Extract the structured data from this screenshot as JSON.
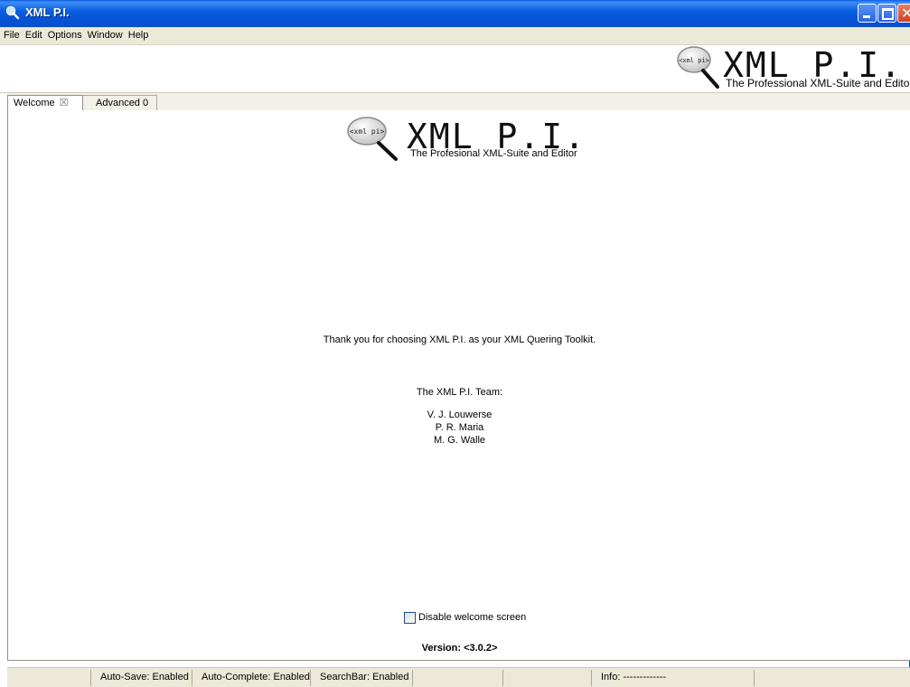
{
  "window": {
    "title": "XML P.I."
  },
  "menu": [
    "File",
    "Edit",
    "Options",
    "Window",
    "Help"
  ],
  "banner": {
    "logo_badge": "<xml pi>",
    "title": "XML P.I.",
    "subtitle": "The Professional XML-Suite and Editor"
  },
  "tabs": [
    {
      "label": "Welcome",
      "close": "☒",
      "active": true
    },
    {
      "label": "Advanced 0",
      "active": false
    }
  ],
  "welcome": {
    "logo_badge": "<xml pi>",
    "title": "XML P.I.",
    "subtitle": "The Profesional XML-Suite and Editor",
    "thanks": "Thank you for choosing XML P.I. as your XML Quering Toolkit.",
    "team_heading": "The XML P.I. Team:",
    "team_members": [
      "V. J. Louwerse",
      "P. R. Maria",
      "M. G. Walle"
    ],
    "disable_label": "Disable welcome screen",
    "disable_checked": false,
    "version": "Version: <3.0.2>"
  },
  "statusbar": {
    "cells": [
      "",
      "Auto-Save: Enabled",
      "Auto-Complete: Enabled",
      "SearchBar: Enabled",
      "",
      "",
      "Info: -------------",
      ""
    ]
  },
  "colors": {
    "titlebar": "#0a5ce6",
    "chrome": "#ece9d8"
  }
}
